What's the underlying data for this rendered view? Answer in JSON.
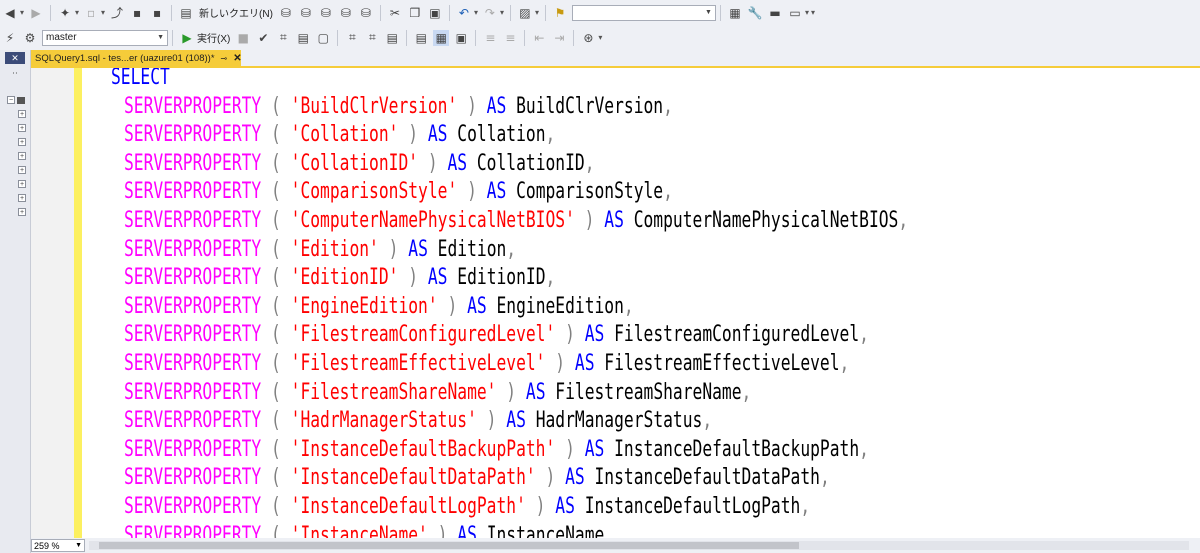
{
  "toolbar": {
    "new_query_label": "新しいクエリ(N)",
    "search_value": "",
    "execute_label": "実行(X)"
  },
  "database_selector": {
    "value": "master"
  },
  "editor_tab": {
    "title": "SQLQuery1.sql - tes...er (uazure01 (108))*"
  },
  "zoom": {
    "value": "259 %"
  },
  "code_lines": [
    [
      {
        "t": "SELECT",
        "c": "kw"
      }
    ],
    [
      {
        "t": "SERVERPROPERTY",
        "c": "fn"
      },
      {
        "t": " ( ",
        "c": "op"
      },
      {
        "t": "'BuildClrVersion'",
        "c": "str"
      },
      {
        "t": " ) ",
        "c": "op"
      },
      {
        "t": "AS",
        "c": "kw"
      },
      {
        "t": " BuildClrVersion",
        "c": "id"
      },
      {
        "t": ",",
        "c": "op"
      }
    ],
    [
      {
        "t": "SERVERPROPERTY",
        "c": "fn"
      },
      {
        "t": " ( ",
        "c": "op"
      },
      {
        "t": "'Collation'",
        "c": "str"
      },
      {
        "t": " ) ",
        "c": "op"
      },
      {
        "t": "AS",
        "c": "kw"
      },
      {
        "t": " Collation",
        "c": "id"
      },
      {
        "t": ",",
        "c": "op"
      }
    ],
    [
      {
        "t": "SERVERPROPERTY",
        "c": "fn"
      },
      {
        "t": " ( ",
        "c": "op"
      },
      {
        "t": "'CollationID'",
        "c": "str"
      },
      {
        "t": " ) ",
        "c": "op"
      },
      {
        "t": "AS",
        "c": "kw"
      },
      {
        "t": " CollationID",
        "c": "id"
      },
      {
        "t": ",",
        "c": "op"
      }
    ],
    [
      {
        "t": "SERVERPROPERTY",
        "c": "fn"
      },
      {
        "t": " ( ",
        "c": "op"
      },
      {
        "t": "'ComparisonStyle'",
        "c": "str"
      },
      {
        "t": " ) ",
        "c": "op"
      },
      {
        "t": "AS",
        "c": "kw"
      },
      {
        "t": " ComparisonStyle",
        "c": "id"
      },
      {
        "t": ",",
        "c": "op"
      }
    ],
    [
      {
        "t": "SERVERPROPERTY",
        "c": "fn"
      },
      {
        "t": " ( ",
        "c": "op"
      },
      {
        "t": "'ComputerNamePhysicalNetBIOS'",
        "c": "str"
      },
      {
        "t": " ) ",
        "c": "op"
      },
      {
        "t": "AS",
        "c": "kw"
      },
      {
        "t": " ComputerNamePhysicalNetBIOS",
        "c": "id"
      },
      {
        "t": ",",
        "c": "op"
      }
    ],
    [
      {
        "t": "SERVERPROPERTY",
        "c": "fn"
      },
      {
        "t": " ( ",
        "c": "op"
      },
      {
        "t": "'Edition'",
        "c": "str"
      },
      {
        "t": " ) ",
        "c": "op"
      },
      {
        "t": "AS",
        "c": "kw"
      },
      {
        "t": " Edition",
        "c": "id"
      },
      {
        "t": ",",
        "c": "op"
      }
    ],
    [
      {
        "t": "SERVERPROPERTY",
        "c": "fn"
      },
      {
        "t": " ( ",
        "c": "op"
      },
      {
        "t": "'EditionID'",
        "c": "str"
      },
      {
        "t": " ) ",
        "c": "op"
      },
      {
        "t": "AS",
        "c": "kw"
      },
      {
        "t": " EditionID",
        "c": "id"
      },
      {
        "t": ",",
        "c": "op"
      }
    ],
    [
      {
        "t": "SERVERPROPERTY",
        "c": "fn"
      },
      {
        "t": " ( ",
        "c": "op"
      },
      {
        "t": "'EngineEdition'",
        "c": "str"
      },
      {
        "t": " ) ",
        "c": "op"
      },
      {
        "t": "AS",
        "c": "kw"
      },
      {
        "t": " EngineEdition",
        "c": "id"
      },
      {
        "t": ",",
        "c": "op"
      }
    ],
    [
      {
        "t": "SERVERPROPERTY",
        "c": "fn"
      },
      {
        "t": " ( ",
        "c": "op"
      },
      {
        "t": "'FilestreamConfiguredLevel'",
        "c": "str"
      },
      {
        "t": " ) ",
        "c": "op"
      },
      {
        "t": "AS",
        "c": "kw"
      },
      {
        "t": " FilestreamConfiguredLevel",
        "c": "id"
      },
      {
        "t": ",",
        "c": "op"
      }
    ],
    [
      {
        "t": "SERVERPROPERTY",
        "c": "fn"
      },
      {
        "t": " ( ",
        "c": "op"
      },
      {
        "t": "'FilestreamEffectiveLevel'",
        "c": "str"
      },
      {
        "t": " ) ",
        "c": "op"
      },
      {
        "t": "AS",
        "c": "kw"
      },
      {
        "t": " FilestreamEffectiveLevel",
        "c": "id"
      },
      {
        "t": ",",
        "c": "op"
      }
    ],
    [
      {
        "t": "SERVERPROPERTY",
        "c": "fn"
      },
      {
        "t": " ( ",
        "c": "op"
      },
      {
        "t": "'FilestreamShareName'",
        "c": "str"
      },
      {
        "t": " ) ",
        "c": "op"
      },
      {
        "t": "AS",
        "c": "kw"
      },
      {
        "t": " FilestreamShareName",
        "c": "id"
      },
      {
        "t": ",",
        "c": "op"
      }
    ],
    [
      {
        "t": "SERVERPROPERTY",
        "c": "fn"
      },
      {
        "t": " ( ",
        "c": "op"
      },
      {
        "t": "'HadrManagerStatus'",
        "c": "str"
      },
      {
        "t": " ) ",
        "c": "op"
      },
      {
        "t": "AS",
        "c": "kw"
      },
      {
        "t": " HadrManagerStatus",
        "c": "id"
      },
      {
        "t": ",",
        "c": "op"
      }
    ],
    [
      {
        "t": "SERVERPROPERTY",
        "c": "fn"
      },
      {
        "t": " ( ",
        "c": "op"
      },
      {
        "t": "'InstanceDefaultBackupPath'",
        "c": "str"
      },
      {
        "t": " ) ",
        "c": "op"
      },
      {
        "t": "AS",
        "c": "kw"
      },
      {
        "t": " InstanceDefaultBackupPath",
        "c": "id"
      },
      {
        "t": ",",
        "c": "op"
      }
    ],
    [
      {
        "t": "SERVERPROPERTY",
        "c": "fn"
      },
      {
        "t": " ( ",
        "c": "op"
      },
      {
        "t": "'InstanceDefaultDataPath'",
        "c": "str"
      },
      {
        "t": " ) ",
        "c": "op"
      },
      {
        "t": "AS",
        "c": "kw"
      },
      {
        "t": " InstanceDefaultDataPath",
        "c": "id"
      },
      {
        "t": ",",
        "c": "op"
      }
    ],
    [
      {
        "t": "SERVERPROPERTY",
        "c": "fn"
      },
      {
        "t": " ( ",
        "c": "op"
      },
      {
        "t": "'InstanceDefaultLogPath'",
        "c": "str"
      },
      {
        "t": " ) ",
        "c": "op"
      },
      {
        "t": "AS",
        "c": "kw"
      },
      {
        "t": " InstanceDefaultLogPath",
        "c": "id"
      },
      {
        "t": ",",
        "c": "op"
      }
    ],
    [
      {
        "t": "SERVERPROPERTY",
        "c": "fn"
      },
      {
        "t": " ( ",
        "c": "op"
      },
      {
        "t": "'InstanceName'",
        "c": "str"
      },
      {
        "t": " ) ",
        "c": "op"
      },
      {
        "t": "AS",
        "c": "kw"
      },
      {
        "t": " InstanceName",
        "c": "id"
      }
    ]
  ],
  "colors": {
    "keyword": "#0000ff",
    "function": "#ff00ff",
    "string": "#ff0000",
    "operator": "#808080",
    "tab_accent": "#f5cc3a",
    "change_bar": "#fcf060"
  }
}
